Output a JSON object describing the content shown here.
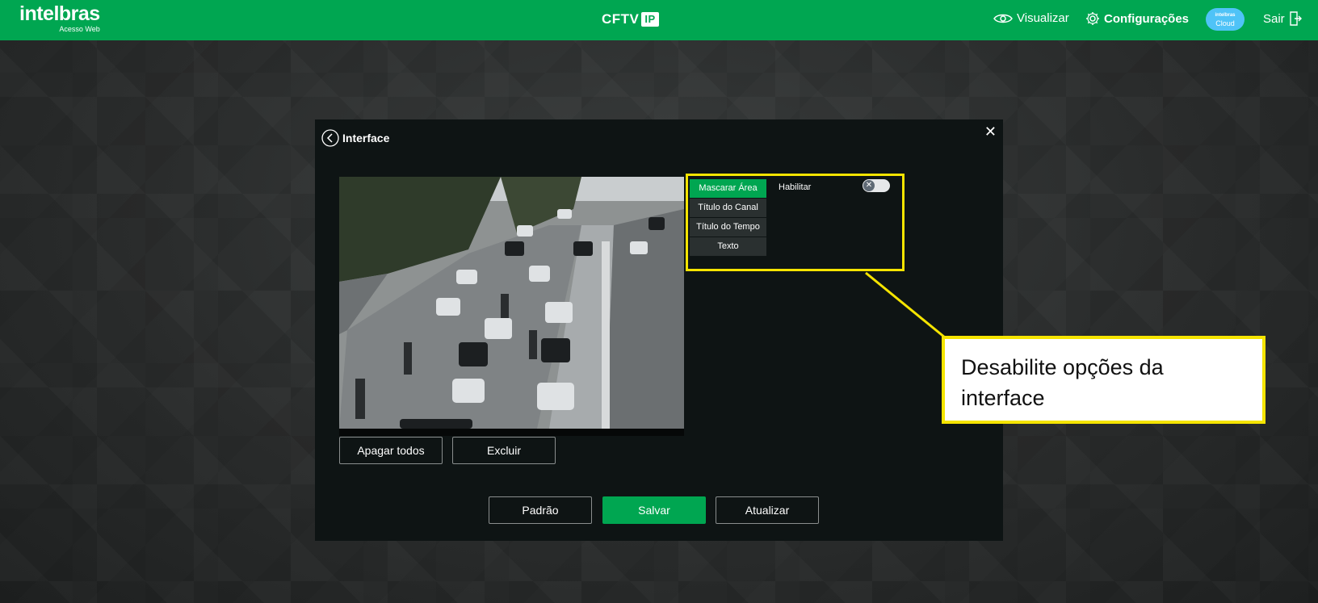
{
  "header": {
    "brand_name": "intelbras",
    "brand_sub": "Acesso Web",
    "center_logo_text": "CFTV",
    "center_logo_badge": "IP",
    "nav": {
      "visualizar": "Visualizar",
      "configuracoes": "Configurações",
      "cloud_line1": "intelbras",
      "cloud_line2": "Cloud",
      "sair": "Sair"
    },
    "brand_color": "#00a651"
  },
  "dialog": {
    "title": "Interface",
    "buttons": {
      "apagar_todos": "Apagar todos",
      "excluir": "Excluir",
      "padrao": "Padrão",
      "salvar": "Salvar",
      "atualizar": "Atualizar"
    },
    "tabs": [
      {
        "label": "Mascarar Área",
        "active": true
      },
      {
        "label": "Título do Canal",
        "active": false
      },
      {
        "label": "Título do Tempo",
        "active": false
      },
      {
        "label": "Texto",
        "active": false
      }
    ],
    "enable_label": "Habilitar",
    "enable_toggle": false
  },
  "annotation": {
    "callout_text": "Desabilite opções da interface",
    "highlight_color": "#f5e400"
  },
  "icons": [
    "back-icon",
    "close-icon",
    "eye-icon",
    "gear-icon",
    "cloud-icon",
    "logout-icon",
    "toggle-off-icon"
  ]
}
